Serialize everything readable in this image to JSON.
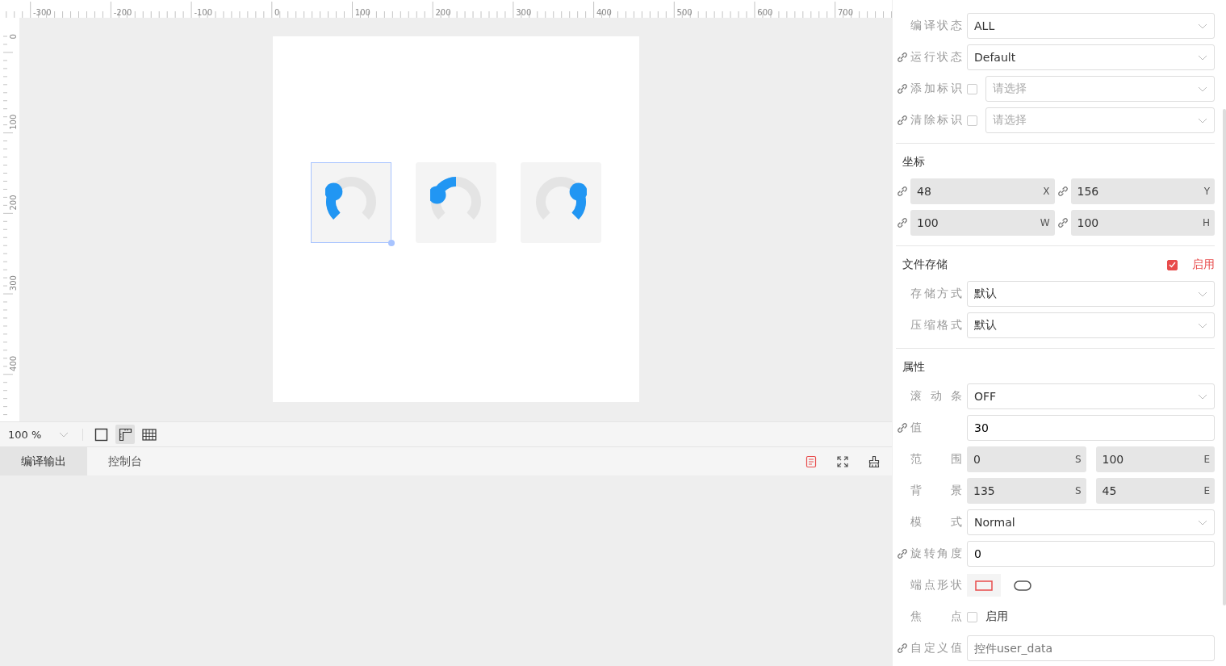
{
  "ruler": {
    "x_labels": [
      "-300",
      "-200",
      "-100",
      "0",
      "100",
      "200",
      "300",
      "400",
      "500",
      "600",
      "700"
    ],
    "y_labels": [
      "0",
      "100",
      "200",
      "300",
      "400"
    ]
  },
  "widgets": [
    {
      "kind": "left",
      "selected": true
    },
    {
      "kind": "top",
      "selected": false
    },
    {
      "kind": "right",
      "selected": false
    }
  ],
  "toolbar": {
    "zoom": "100 %",
    "views": [
      {
        "kind": "frame",
        "selected": false
      },
      {
        "kind": "ruler",
        "selected": true
      },
      {
        "kind": "grid",
        "selected": false
      }
    ]
  },
  "output_tabs": [
    {
      "label": "编译输出",
      "selected": true
    },
    {
      "label": "控制台",
      "selected": false
    }
  ],
  "panel": {
    "sections": [
      {
        "rows": [
          {
            "kind": "select",
            "label": "编译状态",
            "linked": false,
            "value": "ALL"
          },
          {
            "kind": "select",
            "label": "运行状态",
            "linked": true,
            "value": "Default"
          },
          {
            "kind": "check-select",
            "label": "添加标识",
            "linked": true,
            "checked": false,
            "placeholder": "请选择"
          },
          {
            "kind": "check-select",
            "label": "清除标识",
            "linked": true,
            "checked": false,
            "placeholder": "请选择"
          }
        ]
      },
      {
        "title": "坐标",
        "rows": [
          {
            "kind": "coord-pair",
            "fields": [
              {
                "linked": true,
                "value": "48",
                "suffix": "X"
              },
              {
                "linked": true,
                "value": "156",
                "suffix": "Y"
              }
            ]
          },
          {
            "kind": "coord-pair",
            "fields": [
              {
                "linked": true,
                "value": "100",
                "suffix": "W"
              },
              {
                "linked": true,
                "value": "100",
                "suffix": "H"
              }
            ]
          }
        ]
      },
      {
        "title": "文件存储",
        "toggle": {
          "label": "启用",
          "checked": true
        },
        "rows": [
          {
            "kind": "select",
            "label": "存储方式",
            "linked": false,
            "value": "默认"
          },
          {
            "kind": "select",
            "label": "压缩格式",
            "linked": false,
            "value": "默认"
          }
        ]
      },
      {
        "title": "属性",
        "rows": [
          {
            "kind": "select",
            "label": "滚动条",
            "linked": false,
            "value": "OFF"
          },
          {
            "kind": "input",
            "label": "值",
            "linked": true,
            "value": "30"
          },
          {
            "kind": "pair",
            "label": "范围",
            "fields": [
              {
                "value": "0",
                "suffix": "S"
              },
              {
                "value": "100",
                "suffix": "E"
              }
            ]
          },
          {
            "kind": "pair",
            "label": "背景",
            "fields": [
              {
                "value": "135",
                "suffix": "S"
              },
              {
                "value": "45",
                "suffix": "E"
              }
            ]
          },
          {
            "kind": "select",
            "label": "模式",
            "linked": false,
            "value": "Normal"
          },
          {
            "kind": "input",
            "label": "旋转角度",
            "linked": true,
            "value": "0"
          },
          {
            "kind": "shapes",
            "label": "端点形状",
            "options": [
              {
                "kind": "square",
                "selected": true
              },
              {
                "kind": "round",
                "selected": false
              }
            ]
          },
          {
            "kind": "checkbox",
            "label": "焦点",
            "checked": false,
            "text": "启用"
          },
          {
            "kind": "input",
            "label": "自定义值",
            "linked": true,
            "placeholder": "控件user_data"
          }
        ]
      }
    ]
  }
}
